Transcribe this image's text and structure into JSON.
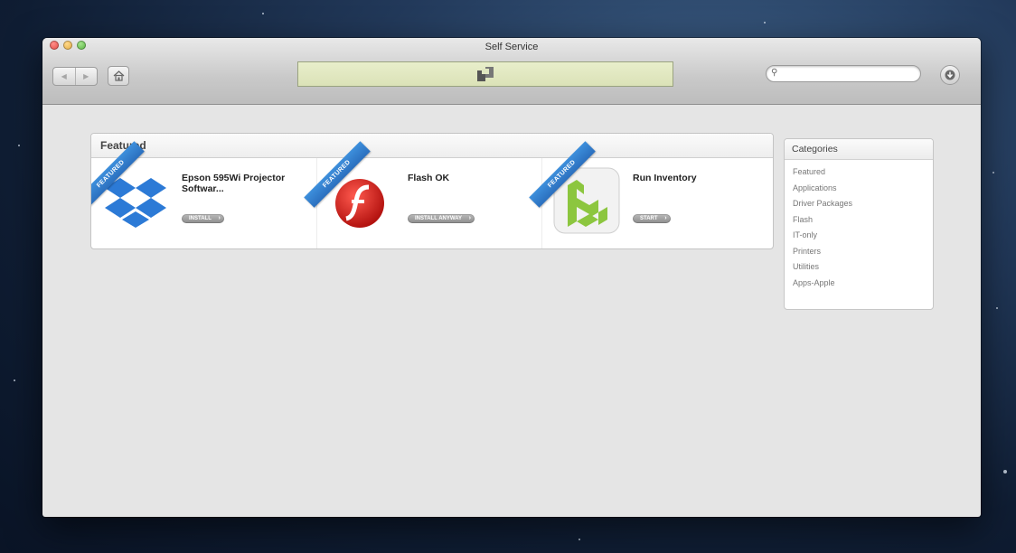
{
  "window": {
    "title": "Self Service"
  },
  "toolbar": {
    "back_label": "◀",
    "forward_label": "▶",
    "search_placeholder": "",
    "icons": [
      "back-arrow-icon",
      "forward-arrow-icon",
      "home-icon",
      "search-icon",
      "download-icon"
    ]
  },
  "featured": {
    "heading": "Featured",
    "ribbon_label": "FEATURED",
    "items": [
      {
        "name": "Epson 595Wi Projector Softwar...",
        "button": "INSTALL",
        "icon": "dropbox-icon"
      },
      {
        "name": "Flash OK",
        "button": "INSTALL ANYWAY",
        "icon": "flash-icon"
      },
      {
        "name": "Run Inventory",
        "button": "START",
        "icon": "inventory-icon"
      }
    ]
  },
  "categories": {
    "heading": "Categories",
    "items": [
      "Featured",
      "Applications",
      "Driver Packages",
      "Flash",
      "IT-only",
      "Printers",
      "Utilities",
      "Apps-Apple"
    ]
  },
  "colors": {
    "ribbon": "#2b6fbe",
    "banner": "#dbe2b7",
    "dropbox_blue": "#2c7ad6",
    "flash_red": "#d3201c",
    "inventory_green": "#8cc63f"
  }
}
